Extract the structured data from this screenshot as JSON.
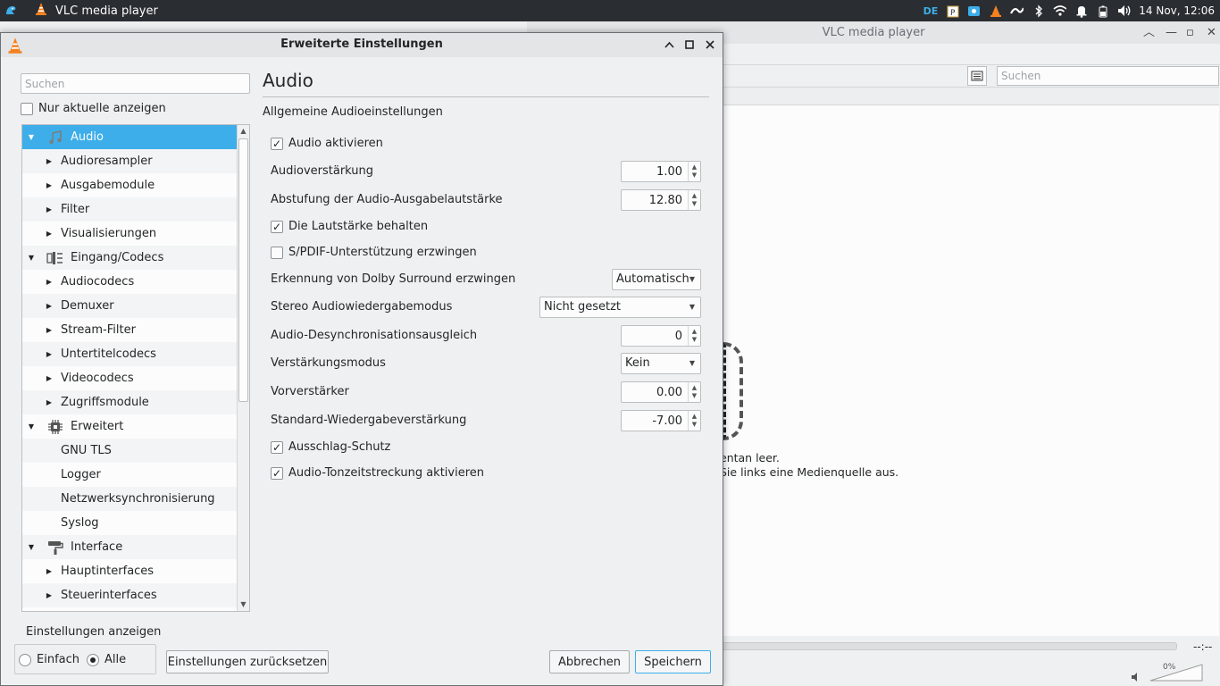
{
  "panel": {
    "app_title": "VLC media player",
    "lang": "DE",
    "clock": "14 Nov, 12:06"
  },
  "main_window": {
    "title": "VLC media player",
    "search_placeholder": "Suchen",
    "empty_line1": "entan leer.",
    "empty_line2": "Sie links eine Medienquelle aus.",
    "time": "--:--",
    "volume": "0%"
  },
  "dialog": {
    "title": "Erweiterte Einstellungen",
    "search_placeholder": "Suchen",
    "only_current_label": "Nur aktuelle anzeigen",
    "tree": [
      {
        "label": "Audio",
        "level": 0,
        "expanded": true,
        "selected": true,
        "icon": "audio-icon"
      },
      {
        "label": "Audioresampler",
        "level": 1
      },
      {
        "label": "Ausgabemodule",
        "level": 1
      },
      {
        "label": "Filter",
        "level": 1
      },
      {
        "label": "Visualisierungen",
        "level": 1
      },
      {
        "label": "Eingang/Codecs",
        "level": 0,
        "expanded": true,
        "icon": "codec-icon"
      },
      {
        "label": "Audiocodecs",
        "level": 1
      },
      {
        "label": "Demuxer",
        "level": 1
      },
      {
        "label": "Stream-Filter",
        "level": 1
      },
      {
        "label": "Untertitelcodecs",
        "level": 1
      },
      {
        "label": "Videocodecs",
        "level": 1
      },
      {
        "label": "Zugriffsmodule",
        "level": 1
      },
      {
        "label": "Erweitert",
        "level": 0,
        "expanded": true,
        "icon": "chip-icon"
      },
      {
        "label": "GNU TLS",
        "level": 2
      },
      {
        "label": "Logger",
        "level": 2
      },
      {
        "label": "Netzwerksynchronisierung",
        "level": 2
      },
      {
        "label": "Syslog",
        "level": 2
      },
      {
        "label": "Interface",
        "level": 0,
        "expanded": true,
        "icon": "paint-roller-icon"
      },
      {
        "label": "Hauptinterfaces",
        "level": 1
      },
      {
        "label": "Steuerinterfaces",
        "level": 1
      }
    ],
    "section": {
      "title": "Audio",
      "subtitle": "Allgemeine Audioeinstellungen",
      "enable_audio": {
        "label": "Audio aktivieren",
        "checked": true
      },
      "gain": {
        "label": "Audioverstärkung",
        "value": "1.00"
      },
      "volume_step": {
        "label": "Abstufung der Audio-Ausgabelautstärke",
        "value": "12.80"
      },
      "keep_volume": {
        "label": "Die Lautstärke behalten",
        "checked": true
      },
      "spdif": {
        "label": "S/PDIF-Unterstützung erzwingen",
        "checked": false
      },
      "dolby": {
        "label": "Erkennung von Dolby Surround erzwingen",
        "value": "Automatisch"
      },
      "stereo_mode": {
        "label": "Stereo Audiowiedergabemodus",
        "value": "Nicht gesetzt"
      },
      "desync": {
        "label": "Audio-Desynchronisationsausgleich",
        "value": "0"
      },
      "gain_mode": {
        "label": "Verstärkungsmodus",
        "value": "Kein"
      },
      "preamp": {
        "label": "Vorverstärker",
        "value": "0.00"
      },
      "default_gain": {
        "label": "Standard-Wiedergabeverstärkung",
        "value": "-7.00"
      },
      "clip_protect": {
        "label": "Ausschlag-Schutz",
        "checked": true
      },
      "time_stretch": {
        "label": "Audio-Tonzeitstreckung aktivieren",
        "checked": true
      }
    },
    "show_settings_label": "Einstellungen anzeigen",
    "mode_simple": "Einfach",
    "mode_all": "Alle",
    "mode_selected": "all",
    "reset_button": "Einstellungen zurücksetzen",
    "cancel_button": "Abbrechen",
    "save_button": "Speichern"
  },
  "colors": {
    "accent": "#3daee9",
    "panel_bg": "#2a2e32",
    "window_bg": "#eff0f1"
  }
}
